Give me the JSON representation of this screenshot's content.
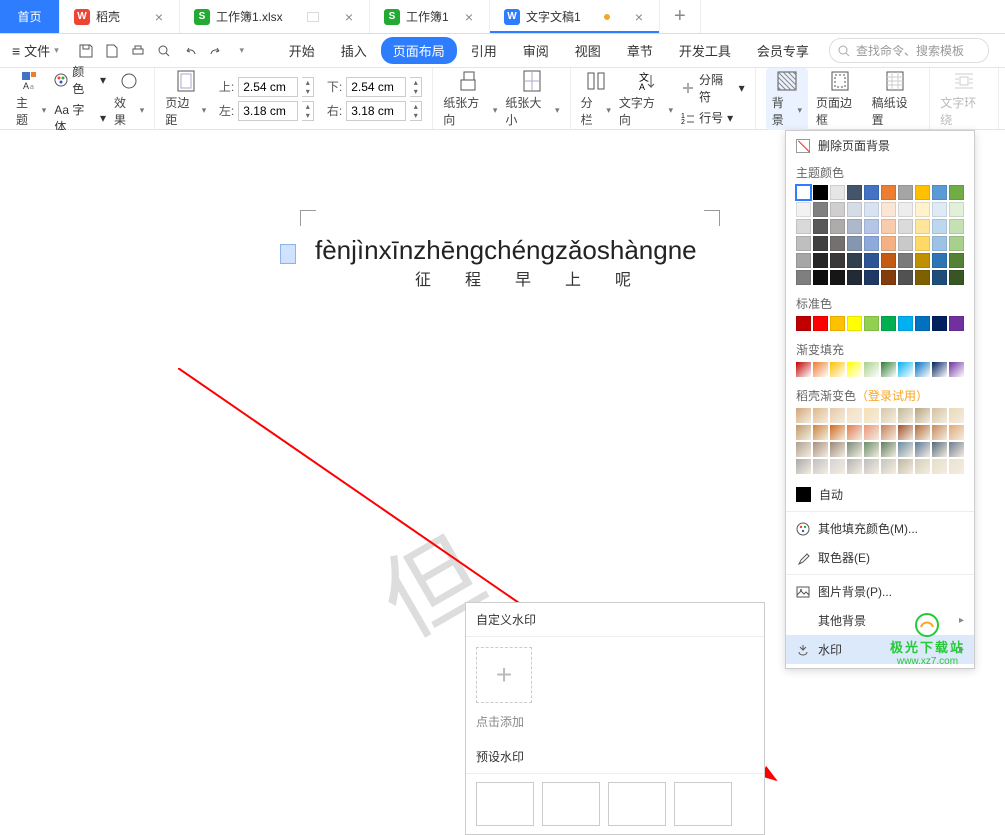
{
  "tabs": {
    "home": "首页",
    "items": [
      {
        "label": "稻壳",
        "icon_bg": "#e43",
        "icon_text": "W"
      },
      {
        "label": "工作簿1.xlsx",
        "icon_bg": "#2a3",
        "icon_text": "S"
      },
      {
        "label": "工作簿1",
        "icon_bg": "#2a3",
        "icon_text": "S"
      },
      {
        "label": "文字文稿1",
        "icon_bg": "#2f7dff",
        "icon_text": "W",
        "active": true,
        "dirty": true
      }
    ]
  },
  "menubar": {
    "file": "文件",
    "menus": [
      "开始",
      "插入",
      "页面布局",
      "引用",
      "审阅",
      "视图",
      "章节",
      "开发工具",
      "会员专享"
    ],
    "active": "页面布局",
    "search_placeholder": "查找命令、搜索模板"
  },
  "ribbon": {
    "text_group": {
      "theme": "主题",
      "color": "颜色",
      "font": "Aa 字体",
      "effect": "效果"
    },
    "margins": {
      "label": "页边距",
      "top_label": "上:",
      "top_value": "2.54 cm",
      "bottom_label": "下:",
      "bottom_value": "2.54 cm",
      "left_label": "左:",
      "left_value": "3.18 cm",
      "right_label": "右:",
      "right_value": "3.18 cm"
    },
    "paper_orient": "纸张方向",
    "paper_size": "纸张大小",
    "columns": "分栏",
    "text_dir": "文字方向",
    "breaks": "分隔符",
    "line_num": "行号",
    "background": "背景",
    "page_border": "页面边框",
    "paper_set": "稿纸设置",
    "text_wrap": "文字环绕"
  },
  "document": {
    "pinyin": "fènjìnxīnzhēngchéngzǎoshàngne",
    "hanzi": "征程早上呢",
    "watermark_sample": "但"
  },
  "wm_popup": {
    "custom_header": "自定义水印",
    "add_label": "点击添加",
    "preset_header": "预设水印"
  },
  "bg_panel": {
    "remove": "删除页面背景",
    "theme_colors": "主题颜色",
    "theme_swatches": [
      [
        "#ffffff",
        "#000000",
        "#e7e6e6",
        "#44546a",
        "#4472c4",
        "#ed7d31",
        "#a5a5a5",
        "#ffc000",
        "#5b9bd5",
        "#70ad47"
      ],
      [
        "#f2f2f2",
        "#808080",
        "#d0cece",
        "#d6dce5",
        "#d9e2f3",
        "#fbe5d5",
        "#ededed",
        "#fff2cc",
        "#deebf6",
        "#e2efd9"
      ],
      [
        "#d9d9d9",
        "#595959",
        "#aeabab",
        "#adb9ca",
        "#b4c6e7",
        "#f7cbac",
        "#dbdbdb",
        "#fee599",
        "#bdd7ee",
        "#c5e0b3"
      ],
      [
        "#bfbfbf",
        "#404040",
        "#757070",
        "#8496b0",
        "#8eaadb",
        "#f4b183",
        "#c9c9c9",
        "#ffd965",
        "#9cc3e5",
        "#a8d08d"
      ],
      [
        "#a6a6a6",
        "#262626",
        "#3a3838",
        "#323f4f",
        "#2f5496",
        "#c55a11",
        "#7b7b7b",
        "#bf9000",
        "#2e75b5",
        "#538135"
      ],
      [
        "#7f7f7f",
        "#0d0d0d",
        "#171616",
        "#222a35",
        "#1f3864",
        "#833c0b",
        "#525252",
        "#7f6000",
        "#1e4e79",
        "#375623"
      ]
    ],
    "standard_colors": "标准色",
    "standard_swatches": [
      "#c00000",
      "#ff0000",
      "#ffc000",
      "#ffff00",
      "#92d050",
      "#00b050",
      "#00b0f0",
      "#0070c0",
      "#002060",
      "#7030a0"
    ],
    "gradient_fill": "渐变填充",
    "gradient_swatches": [
      "#c00000",
      "#ed7d31",
      "#ffc000",
      "#ffff00",
      "#a8d08d",
      "#2e7d32",
      "#00b0f0",
      "#0070c0",
      "#002060",
      "#7030a0"
    ],
    "docer_gradient": "稻壳渐变色",
    "docer_login": "（登录试用）",
    "docer_swatches_rows": [
      [
        "#d2a679",
        "#deb887",
        "#e6c9a8",
        "#f3dfc1",
        "#f5deb3",
        "#d6c9a8",
        "#c2b99b",
        "#b5a47e",
        "#d2c29d",
        "#e8d9b5"
      ],
      [
        "#c19a6b",
        "#cd853f",
        "#d2691e",
        "#e07b53",
        "#e9967a",
        "#c87f59",
        "#a0522d",
        "#b06b3b",
        "#c58b5d",
        "#e0a878"
      ],
      [
        "#b0a090",
        "#a89080",
        "#998877",
        "#7a8b7a",
        "#6b8e6b",
        "#5f7f5f",
        "#6a8ba3",
        "#5d7a9a",
        "#556b7b",
        "#6e7d8d"
      ],
      [
        "#a9a9a9",
        "#c0c0c0",
        "#d3d3d3",
        "#b4b4b4",
        "#bebebe",
        "#c8c4bc",
        "#bfb7a1",
        "#d4ceb8",
        "#e3ddc9",
        "#e8e2d0"
      ]
    ],
    "auto": "自动",
    "more_colors": "其他填充颜色(M)...",
    "eyedropper": "取色器(E)",
    "picture_bg": "图片背景(P)...",
    "other_bg": "其他背景",
    "watermark": "水印",
    "selected_color": "#ffffff"
  },
  "footer": {
    "cn": "极光下载站",
    "url": "www.xz7.com"
  }
}
